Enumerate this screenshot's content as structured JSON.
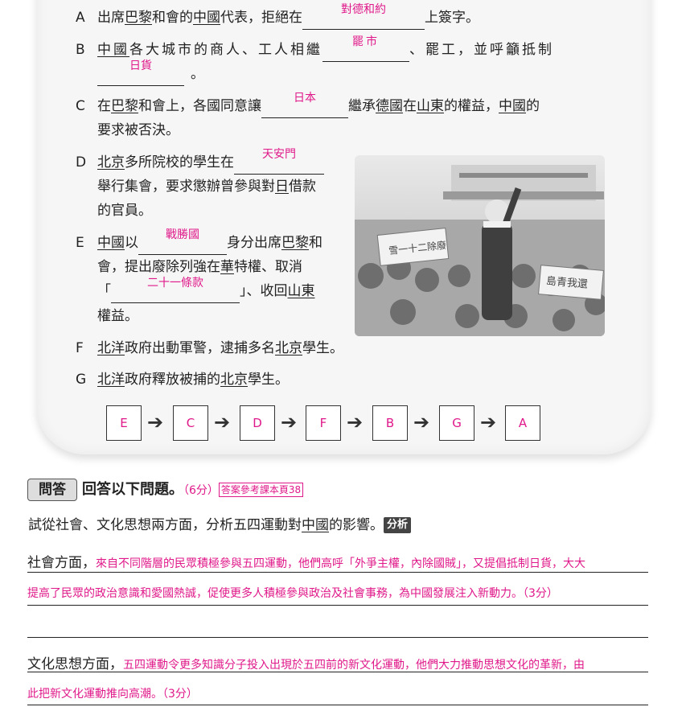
{
  "items": {
    "A": {
      "letter": "A",
      "pre": "出席",
      "place1": "巴黎",
      "mid": "和會的",
      "place2": "中國",
      "post1": "代表，拒絕在",
      "answer": "對德和約",
      "post2": "上簽字。"
    },
    "B": {
      "letter": "B",
      "place1": "中國",
      "pre": "各大城市的商人、工人相繼",
      "answer1": "罷市",
      "mid": "、罷工，並呼籲抵制",
      "answer2": "日貨",
      "end": "。"
    },
    "C": {
      "letter": "C",
      "pre": "在",
      "place1": "巴黎",
      "mid1": "和會上，各國同意讓",
      "answer": "日本",
      "mid2": "繼承",
      "place2": "德國",
      "mid3": "在",
      "place3": "山東",
      "mid4": "的權益，",
      "place4": "中國",
      "mid5": "的",
      "line2": "要求被否決。"
    },
    "D": {
      "letter": "D",
      "place1": "北京",
      "pre": "多所院校的學生在",
      "answer": "天安門",
      "line2a": "舉行集會，要求懲辦曾參與對",
      "place2": "日",
      "line2b": "借款",
      "line3": "的官員。"
    },
    "E": {
      "letter": "E",
      "place1": "中國",
      "pre": "以",
      "answer1": "戰勝國",
      "mid": "身分出席",
      "place2": "巴黎",
      "end1": "和",
      "line2a": "會，提出廢除列強在",
      "place3": "華",
      "line2b": "特權、取消",
      "open": "「",
      "answer2": "二十一條款",
      "close": "」、收回",
      "place4": "山東",
      "line4": "權益。"
    },
    "F": {
      "letter": "F",
      "place1": "北洋",
      "pre": "政府出動軍警，逮捕多名",
      "place2": "北京",
      "end": "學生。"
    },
    "G": {
      "letter": "G",
      "place1": "北洋",
      "pre": "政府釋放被捕的",
      "place2": "北京",
      "end": "學生。"
    }
  },
  "sequence": [
    "E",
    "C",
    "D",
    "F",
    "B",
    "G",
    "A"
  ],
  "arrow": "➔",
  "question": {
    "tag": "問答",
    "title": "回答以下問題。",
    "score": "（6分）",
    "ref": "答案參考課本頁38",
    "prompt_pre": "試從社會、文化思想兩方面，分析五四運動對",
    "prompt_place": "中國",
    "prompt_post": "的影響。",
    "badge": "分析",
    "social_label": "社會方面，",
    "social_line1": "來自不同階層的民眾積極參與五四運動，他們高呼「外爭主權，內除國賊」，又提倡抵制日貨，大大",
    "social_line2": "提高了民眾的政治意識和愛國熱誠，促使更多人積極參與政治及社會事務，為中國發展注入新動力。（3分）",
    "culture_label": "文化思想方面，",
    "culture_line1": "五四運動令更多知識分子投入出現於五四前的新文化運動，他們大力推動思想文化的革新，由",
    "culture_line2": "此把新文化運動推向高潮。（3分）"
  },
  "photo": {
    "banner_left": "雪一十二除廢",
    "banner_right": "島青我還"
  },
  "colors": {
    "answer": "#e0198a",
    "border": "#222222"
  }
}
